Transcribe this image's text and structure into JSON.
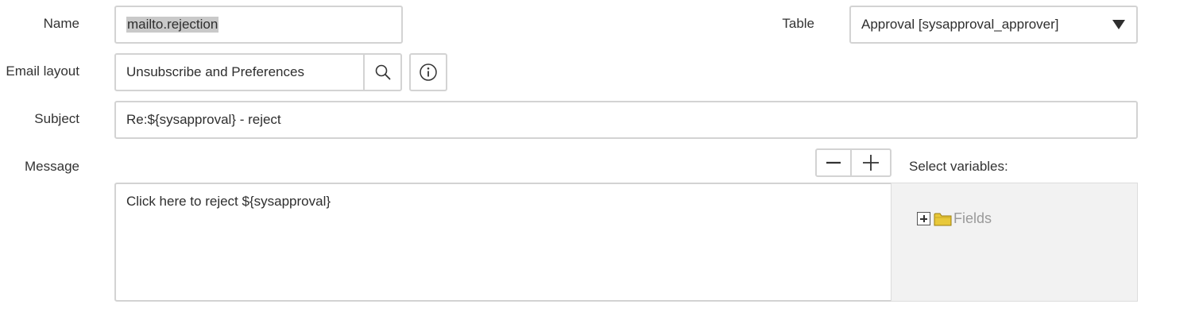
{
  "form": {
    "name": {
      "label": "Name",
      "value": "mailto.rejection"
    },
    "table": {
      "label": "Table",
      "value": "Approval [sysapproval_approver]"
    },
    "email_layout": {
      "label": "Email layout",
      "value": "Unsubscribe and Preferences"
    },
    "subject": {
      "label": "Subject",
      "value": "Re:${sysapproval} - reject"
    },
    "message": {
      "label": "Message",
      "value": "Click here to reject ${sysapproval}"
    }
  },
  "variables": {
    "heading": "Select variables:",
    "tree": [
      {
        "label": "Fields",
        "icon": "folder-icon",
        "expanded": false
      }
    ]
  },
  "icons": {
    "lookup": "search-icon",
    "info": "info-icon",
    "decrease": "minus-icon",
    "increase": "plus-icon",
    "dropdown": "triangle-down-icon"
  },
  "colors": {
    "border": "#d3d3d3",
    "panel_background": "#f2f2f2",
    "selection": "#c9c9c9",
    "folder": "#e8c83a"
  }
}
